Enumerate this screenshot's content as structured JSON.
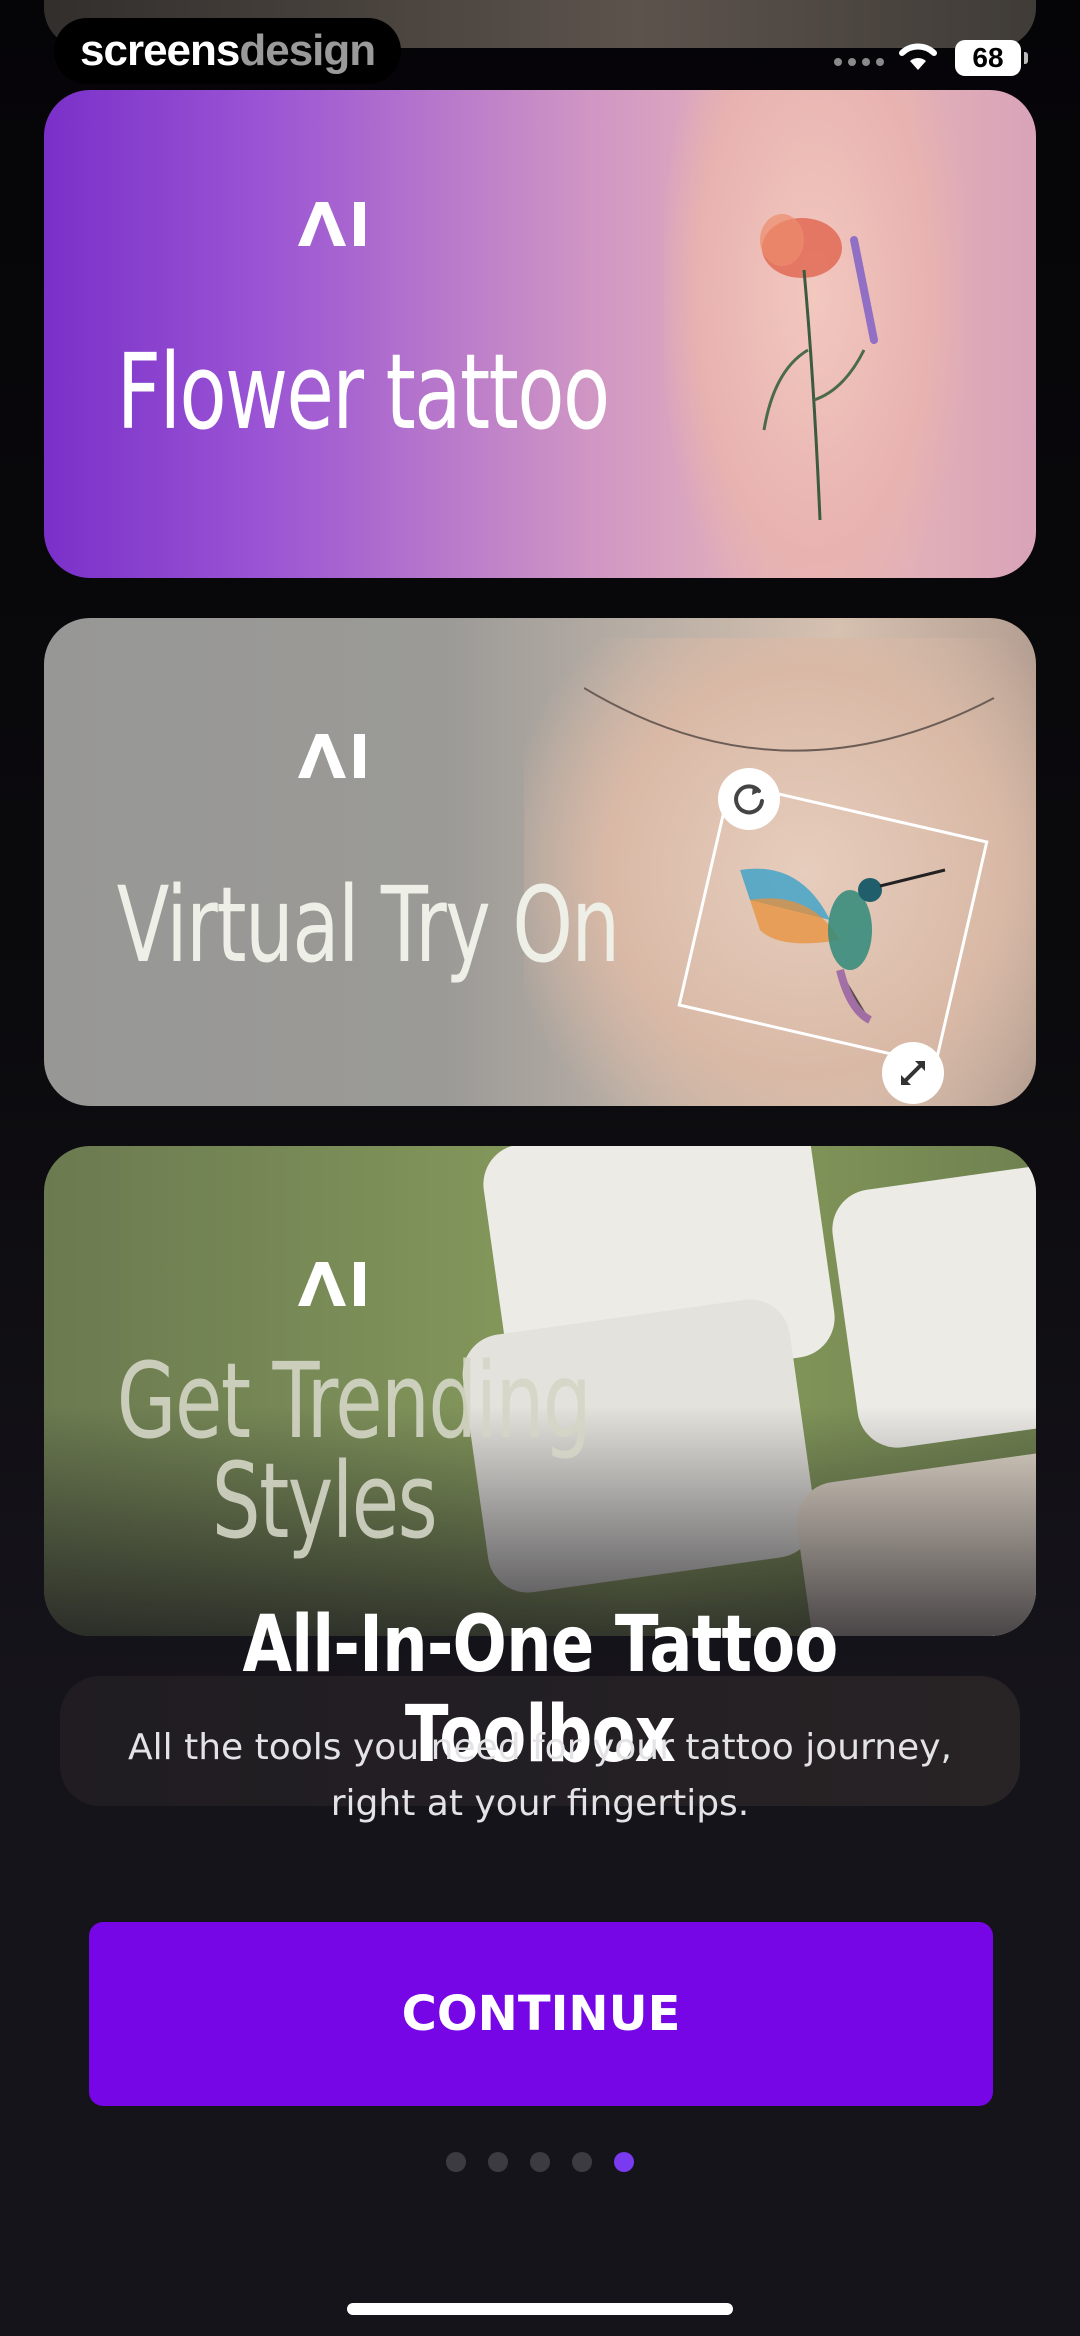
{
  "status_bar": {
    "brand_part1": "screens",
    "brand_part2": "design",
    "battery": "68"
  },
  "cards": [
    {
      "badge": "AI",
      "title": "Flower tattoo"
    },
    {
      "badge": "AI",
      "title": "Virtual Try On"
    },
    {
      "badge": "AI",
      "title_line1": "Get Trending",
      "title_line2": "Styles"
    }
  ],
  "headline": "All-In-One Tattoo Toolbox",
  "subtitle": "All the tools you need for your tattoo journey, right at your fingertips.",
  "cta": {
    "label": "CONTINUE"
  },
  "pager": {
    "total": 5,
    "current": 5
  },
  "colors": {
    "accent": "#7706e6",
    "background": "#16141b",
    "dot_active": "#7a3af0"
  }
}
